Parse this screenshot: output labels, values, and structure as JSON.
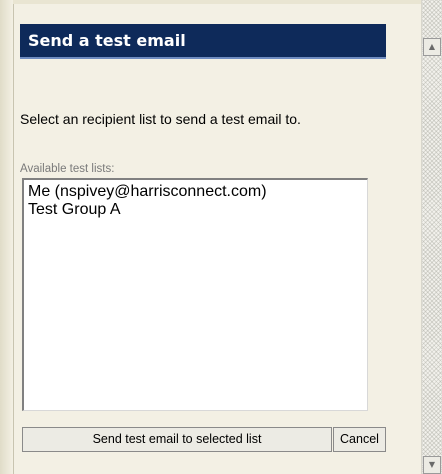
{
  "dialog": {
    "title": "Send a test email",
    "instruction": "Select an recipient list to send a test email to.",
    "list_label": "Available test lists:",
    "test_lists": [
      "Me (nspivey@harrisconnect.com)",
      "Test Group A"
    ],
    "send_button_label": "Send test email to selected list",
    "cancel_button_label": "Cancel"
  },
  "scrollbar": {
    "up_icon": "▲",
    "down_icon": "▼"
  },
  "colors": {
    "title_bar": "#0e2a5a",
    "background": "#f3f0e4"
  }
}
